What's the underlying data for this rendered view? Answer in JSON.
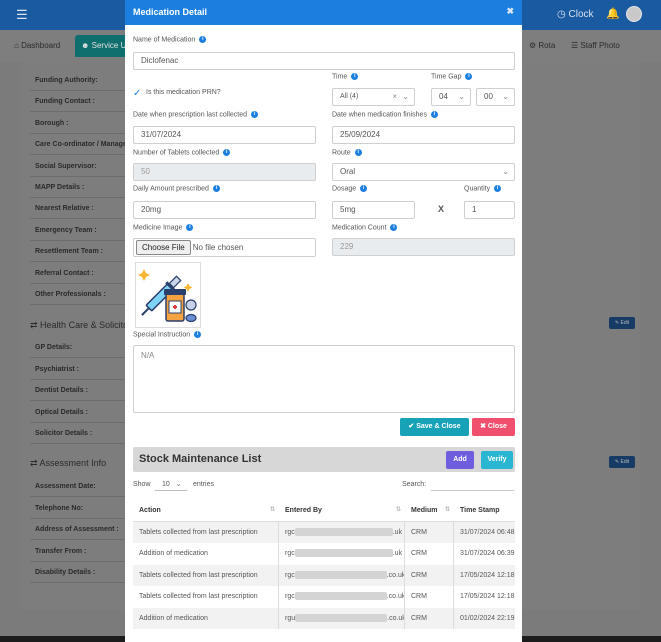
{
  "header": {
    "clock_label": "Clock"
  },
  "subnav": {
    "dashboard": "Dashboard",
    "service_users": "Service U",
    "rota": "Rota",
    "staff_photo": "Staff Photo"
  },
  "background": {
    "rows": [
      "Funding Authority:",
      "Funding Contact :",
      "Borough :",
      "Care Co-ordinator / Manager :",
      "Social Supervisor:",
      "MAPP Details :",
      "Nearest Relative :",
      "Emergency Team :",
      "Resettlement Team :",
      "Referral Contact :",
      "Other Professionals :"
    ],
    "health_heading": "Health Care & Solicitors",
    "health_rows": [
      "GP Details:",
      "Psychiatrist :",
      "Dentist Details :",
      "Optical Details :",
      "Solicitor Details :"
    ],
    "assessment_heading": "Assessment Info",
    "assessment_rows": [
      "Assessment Date:",
      "Telephone No:",
      "Address of Assessment :",
      "Transfer From :",
      "Disability Details :"
    ],
    "edit_label": "Edit"
  },
  "modal": {
    "title": "Medication Detail",
    "name_label": "Name of Medication",
    "name_value": "Diclofenac",
    "prn_label": "Is this medication PRN?",
    "time_label": "Time",
    "time_value": "All (4)",
    "time_gap_label": "Time Gap",
    "time_gap_hours": "04",
    "time_gap_minutes": "00",
    "date_collected_label": "Date when prescription last collected",
    "date_collected_value": "31/07/2024",
    "date_finish_label": "Date when medication finishes",
    "date_finish_value": "25/09/2024",
    "tablets_label": "Number of Tablets collected",
    "tablets_value": "50",
    "route_label": "Route",
    "route_value": "Oral",
    "daily_label": "Daily Amount prescribed",
    "daily_value": "20mg",
    "dosage_label": "Dosage",
    "dosage_value": "5mg",
    "multiply": "X",
    "quantity_label": "Quantity",
    "quantity_value": "1",
    "image_label": "Medicine Image",
    "choose_file": "Choose File",
    "no_file": "No file chosen",
    "count_label": "Medication Count",
    "count_value": "229",
    "instruction_label": "Special Instruction",
    "instruction_value": "N/A",
    "save_close": "Save & Close",
    "close": "Close"
  },
  "stock": {
    "title": "Stock Maintenance List",
    "add": "Add",
    "verify": "Verify",
    "show_label": "Show",
    "show_value": "10",
    "entries_label": "entries",
    "search_label": "Search:",
    "columns": [
      "Action",
      "Entered By",
      "Medium",
      "Time Stamp"
    ],
    "rows": [
      {
        "action": "Tablets collected from last prescription",
        "by_start": "rgc",
        "by_end": ".uk",
        "medium": "CRM",
        "time": "31/07/2024 06:48"
      },
      {
        "action": "Addition of medication",
        "by_start": "rgc",
        "by_end": ".uk",
        "medium": "CRM",
        "time": "31/07/2024 06:39"
      },
      {
        "action": "Tablets collected from last prescription",
        "by_start": "rgc",
        "by_end": ".co.uk",
        "medium": "CRM",
        "time": "17/05/2024 12:18"
      },
      {
        "action": "Tablets collected from last prescription",
        "by_start": "rgc",
        "by_end": ".co.uk",
        "medium": "CRM",
        "time": "17/05/2024 12:18"
      },
      {
        "action": "Addition of medication",
        "by_start": "rgu",
        "by_end": ".co.uk",
        "medium": "CRM",
        "time": "01/02/2024 22:19"
      }
    ]
  }
}
